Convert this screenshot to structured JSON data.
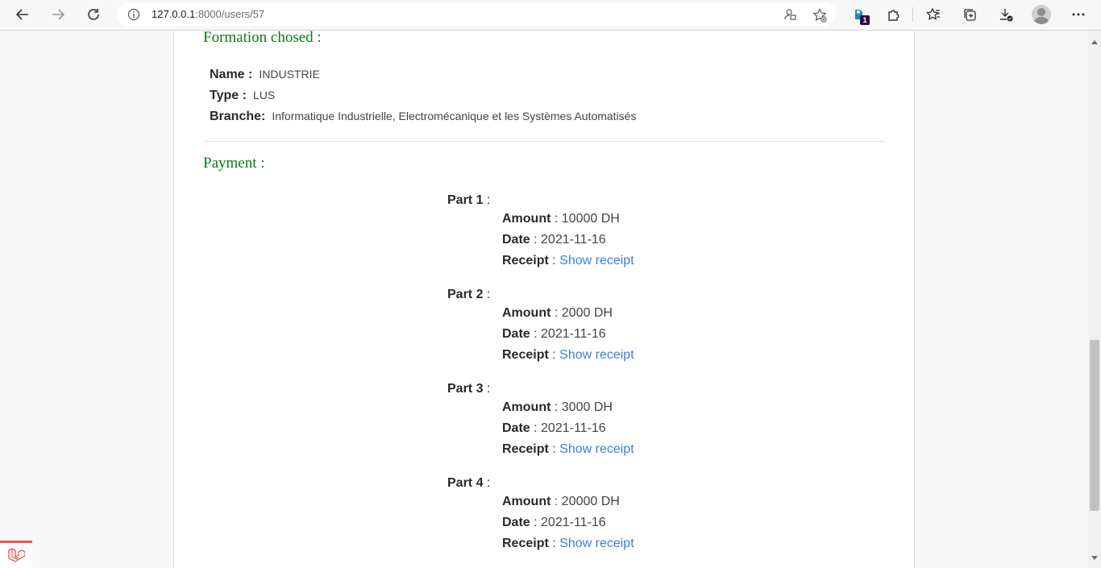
{
  "browser": {
    "url_host": "127.0.0.1",
    "url_rest": ":8000/users/57",
    "extension_badge": "1"
  },
  "formation": {
    "title": "Formation chosed :",
    "name_label": "Name :",
    "name_value": "INDUSTRIE",
    "type_label": "Type :",
    "type_value": "LUS",
    "branche_label": "Branche:",
    "branche_value": "Informatique Industrielle, Electromécanique et les Systèmes Automatisés"
  },
  "payment": {
    "title": "Payment :",
    "amount_label": "Amount",
    "date_label": "Date",
    "receipt_label": "Receipt",
    "parts": [
      {
        "label": "Part 1",
        "amount": "10000 DH",
        "date": "2021-11-16",
        "receipt_link": "Show receipt"
      },
      {
        "label": "Part 2",
        "amount": "2000 DH",
        "date": "2021-11-16",
        "receipt_link": "Show receipt"
      },
      {
        "label": "Part 3",
        "amount": "3000 DH",
        "date": "2021-11-16",
        "receipt_link": "Show receipt"
      },
      {
        "label": "Part 4",
        "amount": "20000 DH",
        "date": "2021-11-16",
        "receipt_link": "Show receipt"
      }
    ]
  },
  "colors": {
    "section_title": "#107a10",
    "link": "#3b7fdc",
    "laravel_red": "#ef5350"
  }
}
